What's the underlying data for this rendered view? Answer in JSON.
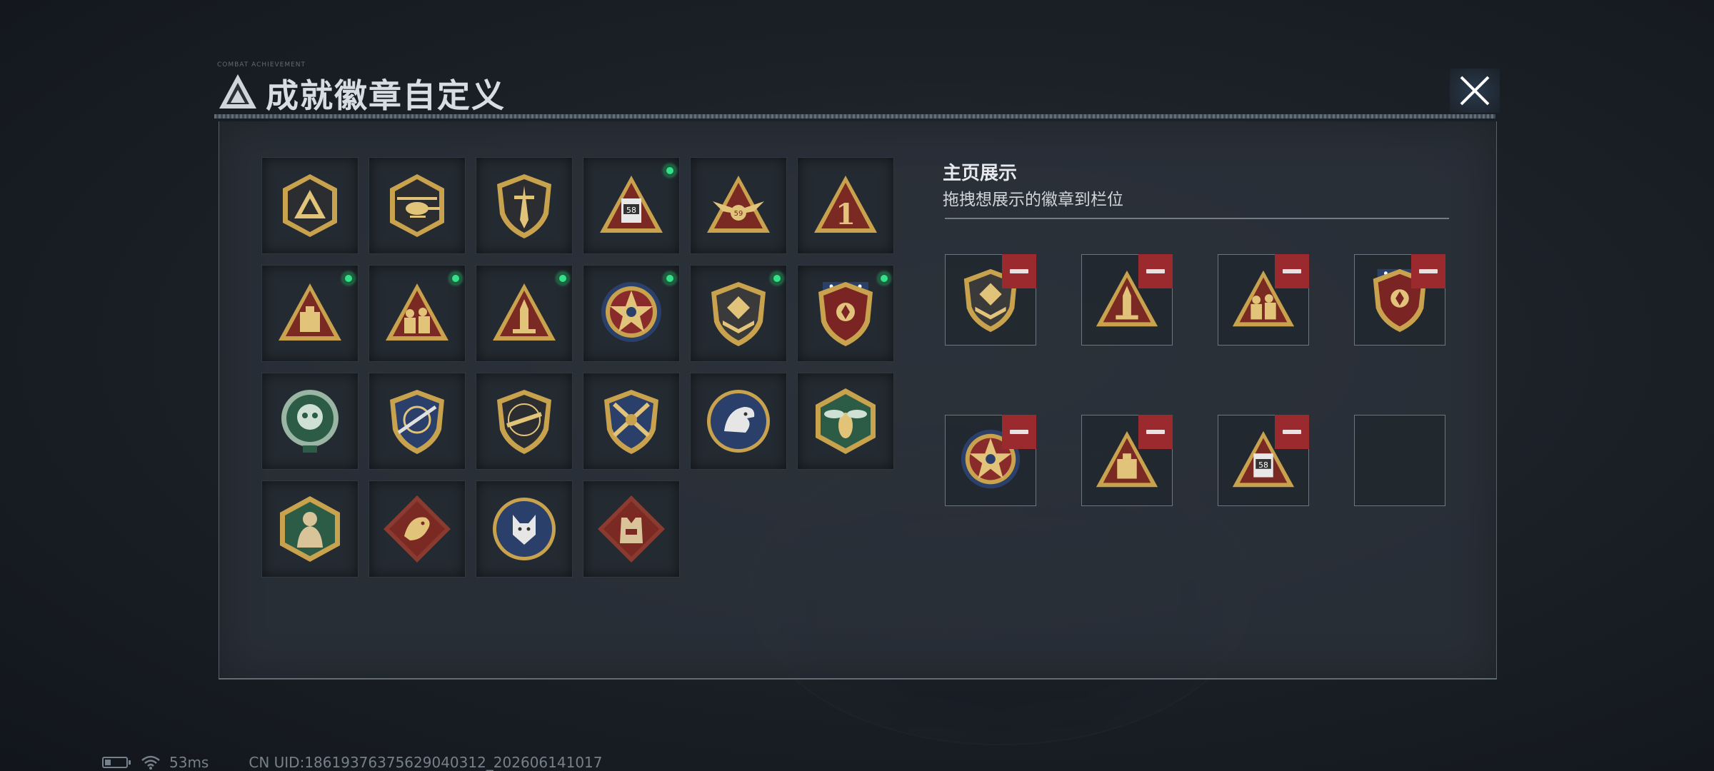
{
  "header": {
    "title": "成就徽章自定义",
    "tiny_text": "COMBAT ACHIEVEMENT"
  },
  "badge_grid": {
    "badges": [
      {
        "icon": "triangle-shield-badge-icon",
        "new": false
      },
      {
        "icon": "helicopter-shield-badge-icon",
        "new": false
      },
      {
        "icon": "dagger-shield-badge-icon",
        "new": false
      },
      {
        "icon": "robot-58-triangle-badge-icon",
        "new": true
      },
      {
        "icon": "eagle-59-triangle-badge-icon",
        "new": false
      },
      {
        "icon": "number-1-triangle-badge-icon",
        "new": false
      },
      {
        "icon": "supply-box-triangle-badge-icon",
        "new": true
      },
      {
        "icon": "soldiers-triangle-badge-icon",
        "new": true
      },
      {
        "icon": "rocket-triangle-badge-icon",
        "new": true
      },
      {
        "icon": "star-medal-badge-icon",
        "new": true
      },
      {
        "icon": "chevron-shield-badge-icon",
        "new": true
      },
      {
        "icon": "laurel-shield-badge-icon",
        "new": true
      },
      {
        "icon": "green-skull-badge-icon",
        "new": false
      },
      {
        "icon": "crosshair-rifle-badge-icon",
        "new": false
      },
      {
        "icon": "rifle-shield-badge-icon",
        "new": false
      },
      {
        "icon": "crossed-guns-badge-icon",
        "new": false
      },
      {
        "icon": "eagle-head-badge-icon",
        "new": false
      },
      {
        "icon": "hornet-hexagon-badge-icon",
        "new": false
      },
      {
        "icon": "brute-hexagon-badge-icon",
        "new": false
      },
      {
        "icon": "dragon-diamond-badge-icon",
        "new": false
      },
      {
        "icon": "wolf-circle-badge-icon",
        "new": false
      },
      {
        "icon": "vest-diamond-badge-icon",
        "new": false
      }
    ]
  },
  "display": {
    "title": "主页展示",
    "subtitle": "拖拽想展示的徽章到栏位",
    "slots": [
      {
        "icon": "chevron-shield-badge-icon"
      },
      {
        "icon": "rocket-triangle-badge-icon"
      },
      {
        "icon": "soldiers-triangle-badge-icon"
      },
      {
        "icon": "laurel-shield-badge-icon"
      },
      {
        "icon": "star-medal-badge-icon"
      },
      {
        "icon": "supply-box-triangle-badge-icon"
      },
      {
        "icon": "robot-58-triangle-badge-icon"
      },
      {
        "icon": null
      }
    ]
  },
  "footer": {
    "ping": "53ms",
    "uid": "CN UID:18619376375629040312_202606141017"
  },
  "colors": {
    "gold": "#c9a24e",
    "dark_red": "#7a2a22",
    "green_dot": "#35e08a",
    "remove_red": "#9a2a2e",
    "navy": "#2a3f6a",
    "green": "#2c5c45"
  }
}
